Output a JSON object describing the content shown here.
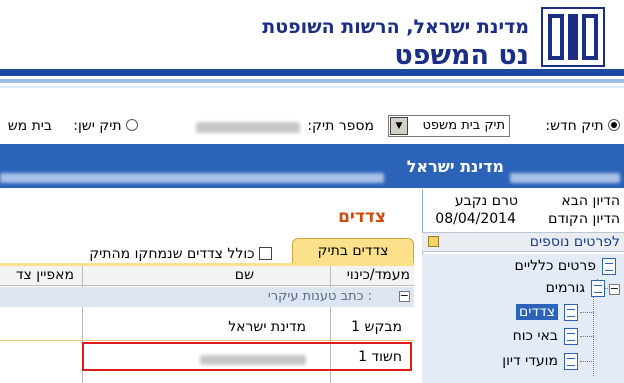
{
  "header": {
    "org": "מדינת ישראל, הרשות השופטת",
    "title": "נט המשפט",
    "colors": {
      "brand": "#1b2e84",
      "band": "#1b4aa0"
    }
  },
  "file_bar": {
    "new_file_label": "תיק חדש:",
    "court_select_value": "תיק בית משפט",
    "file_number_label": "מספר תיק:",
    "old_file_label": "תיק ישן:",
    "court_label": "בית מש"
  },
  "case_bar": {
    "party_name": "מדינת ישראל",
    "accent": "#2a63b7"
  },
  "sidebar": {
    "next_hearing_label": "הדיון הבא",
    "next_hearing_value": "טרם נקבע",
    "prev_hearing_label": "הדיון הקודם",
    "prev_hearing_value": "08/04/2014",
    "more_details_label": "לפרטים נוספים",
    "tree": {
      "general_details": "פרטים כלליים",
      "entities": "גורמים",
      "parties": "צדדים",
      "attorneys": "באי כוח",
      "hearing_dates": "מועדי דיון"
    }
  },
  "main": {
    "section_title": "צדדים",
    "tab_parties_in_file": "צדדים בתיק",
    "include_deleted_label": "כולל צדדים שנמחקו מהתיק",
    "columns": {
      "status_alias": "מעמד/כינוי",
      "name": "שם",
      "party_attribute": "מאפיין צד"
    },
    "group_label": ": כתב טענות עיקרי",
    "rows": [
      {
        "status": "מבקש 1",
        "name": "מדינת ישראל"
      },
      {
        "status": "חשוד 1",
        "name": ""
      }
    ],
    "title_color": "#cf4b0e",
    "tab_color": "#fde08a"
  }
}
